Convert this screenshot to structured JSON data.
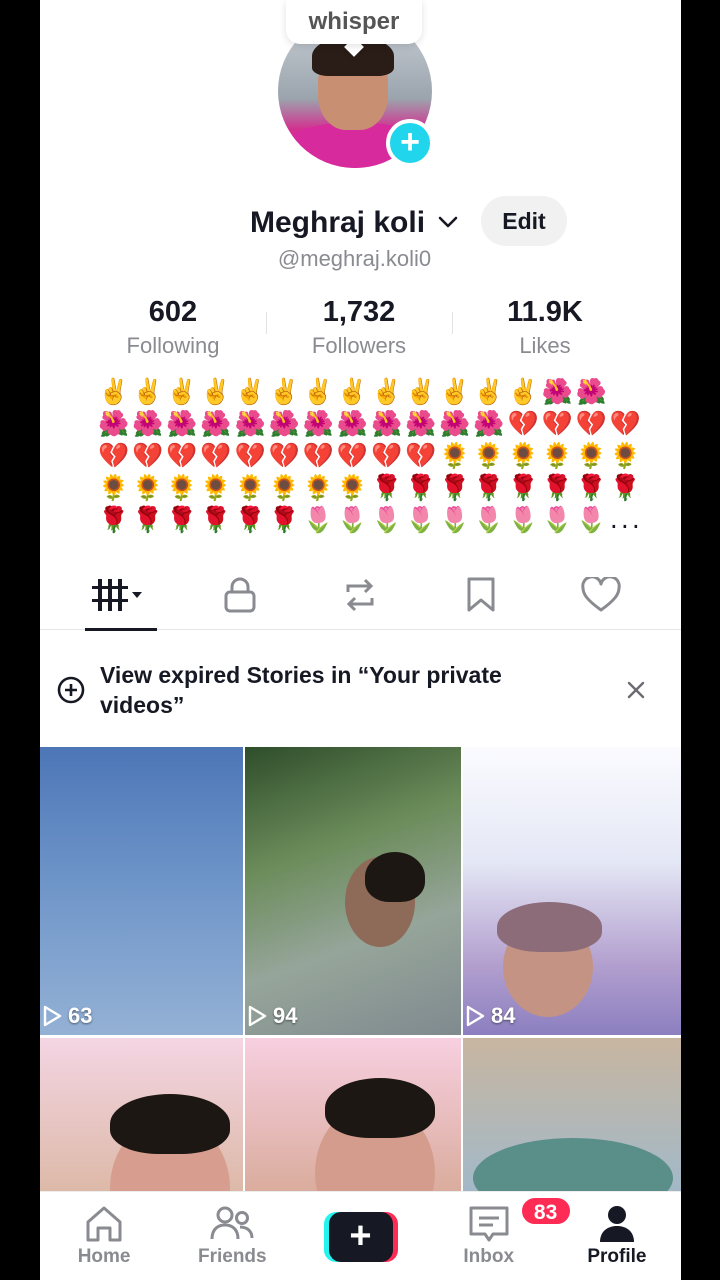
{
  "bubble": {
    "text": "whisper"
  },
  "profile": {
    "display_name": "Meghraj koli",
    "username": "@meghraj.koli0",
    "edit_label": "Edit"
  },
  "stats": [
    {
      "value": "602",
      "label": "Following"
    },
    {
      "value": "1,732",
      "label": "Followers"
    },
    {
      "value": "11.9K",
      "label": "Likes"
    }
  ],
  "bio": {
    "lines": [
      "✌️✌️✌️✌️✌️✌️✌️✌️✌️✌️✌️✌️✌️🌺🌺",
      "🌺🌺🌺🌺🌺🌺🌺🌺🌺🌺🌺🌺💔💔💔💔",
      "💔💔💔💔💔💔💔💔💔💔🌻🌻🌻🌻🌻🌻",
      "🌻🌻🌻🌻🌻🌻🌻🌻🌹🌹🌹🌹🌹🌹🌹🌹",
      "🌹🌹🌹🌹🌹🌹🌷🌷🌷🌷🌷🌷🌷🌷🌷..."
    ]
  },
  "tabs": [
    {
      "name": "videos",
      "icon": "grid-icon",
      "active": true
    },
    {
      "name": "private",
      "icon": "lock-icon",
      "active": false
    },
    {
      "name": "reposts",
      "icon": "repost-icon",
      "active": false
    },
    {
      "name": "favorites",
      "icon": "bookmark-icon",
      "active": false
    },
    {
      "name": "liked",
      "icon": "heart-icon",
      "active": false
    }
  ],
  "banner": {
    "text": "View expired Stories in “Your private videos”"
  },
  "videos": [
    {
      "views": "63"
    },
    {
      "views": "94"
    },
    {
      "views": "84"
    },
    {
      "views": ""
    },
    {
      "views": ""
    },
    {
      "views": ""
    }
  ],
  "nav": {
    "home": "Home",
    "friends": "Friends",
    "create": "+",
    "inbox": "Inbox",
    "inbox_badge": "83",
    "profile": "Profile"
  },
  "colors": {
    "accent_pink": "#fe2c55",
    "accent_cyan": "#25f4ee",
    "text_primary": "#161823",
    "text_secondary": "#8a8b91"
  }
}
